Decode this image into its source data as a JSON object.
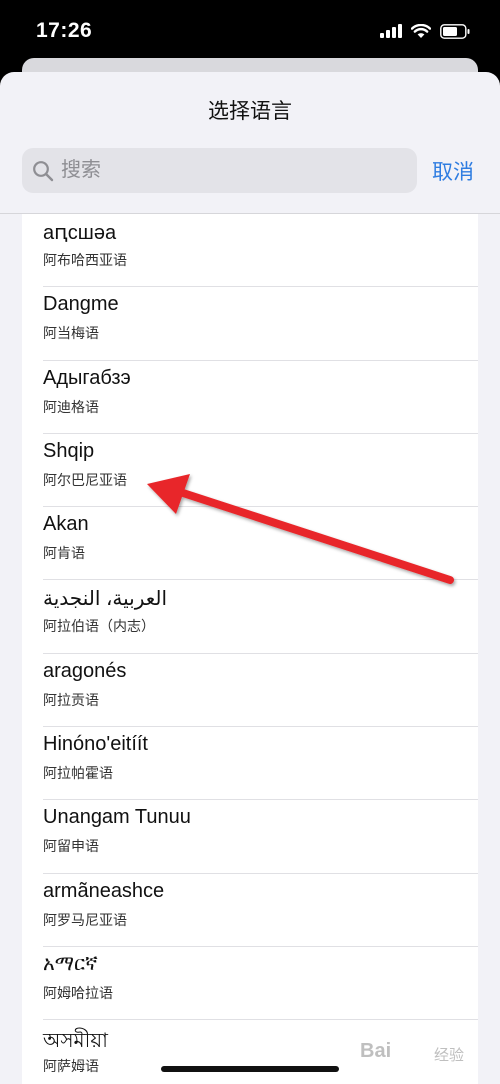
{
  "status_bar": {
    "time": "17:26",
    "icons": [
      "signal-icon",
      "wifi-icon",
      "battery-icon"
    ]
  },
  "sheet": {
    "title": "选择语言",
    "search": {
      "placeholder": "搜索",
      "value": ""
    },
    "cancel_label": "取消"
  },
  "languages": [
    {
      "native": "aԥсшәа",
      "local": "阿布哈西亚语"
    },
    {
      "native": "Dangme",
      "local": "阿当梅语"
    },
    {
      "native": "Адыгабзэ",
      "local": "阿迪格语"
    },
    {
      "native": "Shqip",
      "local": "阿尔巴尼亚语"
    },
    {
      "native": "Akan",
      "local": "阿肯语"
    },
    {
      "native": "العربية، النجدية",
      "local": "阿拉伯语（内志）"
    },
    {
      "native": "aragonés",
      "local": "阿拉贡语"
    },
    {
      "native": "Hinóno'eitíít",
      "local": "阿拉帕霍语"
    },
    {
      "native": "Unangam Tunuu",
      "local": "阿留申语"
    },
    {
      "native": "armãneashce",
      "local": "阿罗马尼亚语"
    },
    {
      "native": "አማርኛ",
      "local": "阿姆哈拉语"
    },
    {
      "native": "অসমীয়া",
      "local": "阿萨姆语"
    }
  ],
  "colors": {
    "accent": "#2f7de1",
    "arrow": "#e8262a",
    "sheet_bg": "#f2f2f7"
  },
  "watermark": {
    "brand": "Bai",
    "sub": "经验"
  }
}
